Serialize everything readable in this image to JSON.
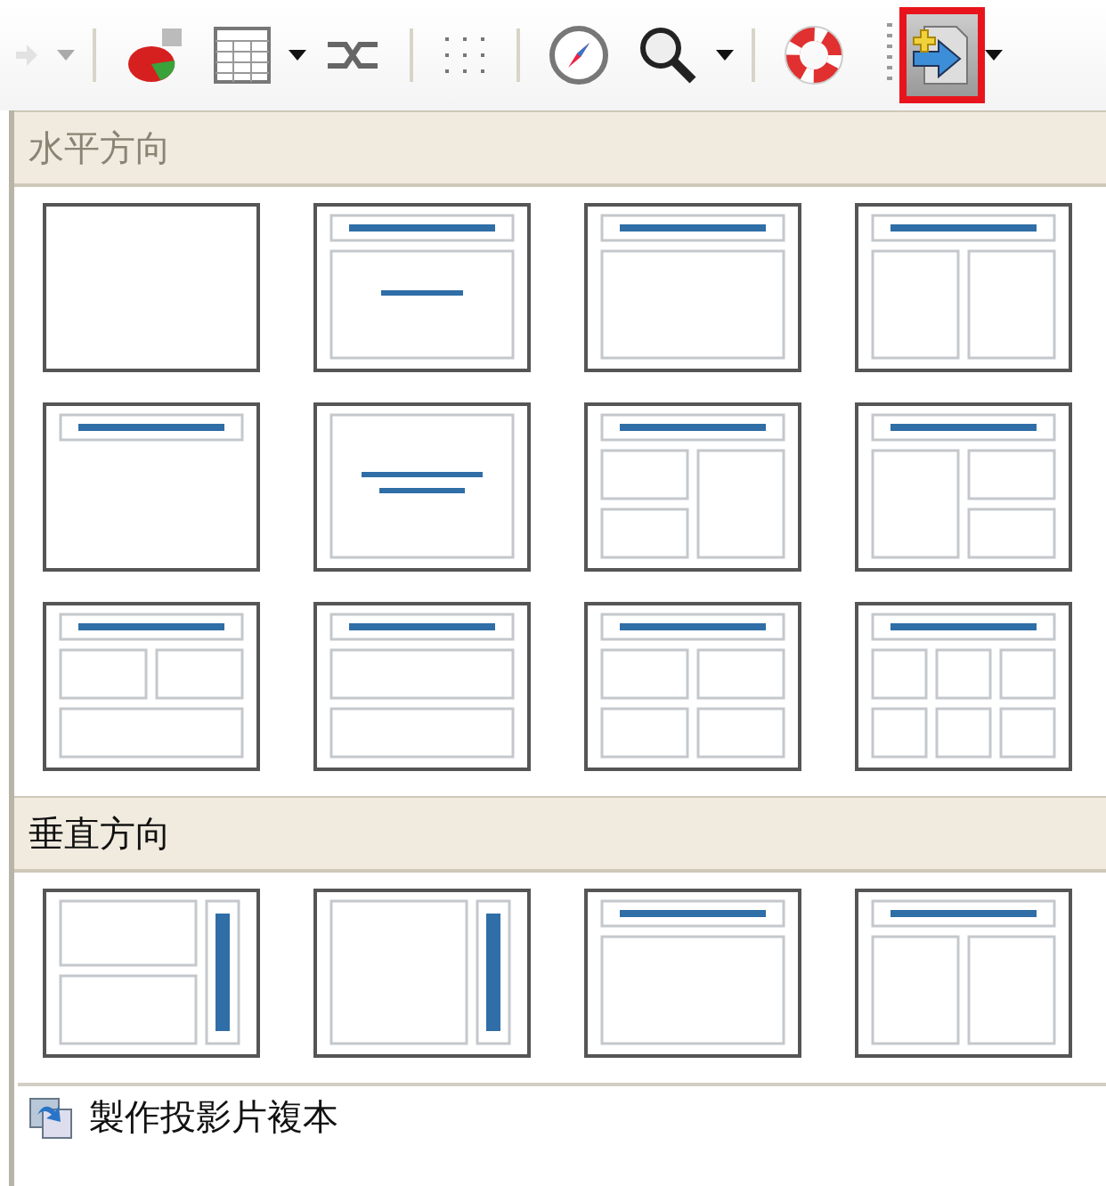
{
  "toolbar": [
    {
      "kind": "forward",
      "disabled": true,
      "dropdown": true,
      "selected": false
    },
    {
      "kind": "separator"
    },
    {
      "kind": "chart",
      "disabled": false,
      "dropdown": false,
      "selected": false
    },
    {
      "kind": "table",
      "disabled": false,
      "dropdown": true,
      "selected": false
    },
    {
      "kind": "link",
      "disabled": false,
      "dropdown": false,
      "selected": false
    },
    {
      "kind": "separator"
    },
    {
      "kind": "grid",
      "disabled": false,
      "dropdown": false,
      "selected": false
    },
    {
      "kind": "separator"
    },
    {
      "kind": "navigator",
      "disabled": false,
      "dropdown": false,
      "selected": false
    },
    {
      "kind": "zoom",
      "disabled": false,
      "dropdown": true,
      "selected": false
    },
    {
      "kind": "separator"
    },
    {
      "kind": "help",
      "disabled": false,
      "dropdown": false,
      "selected": false
    },
    {
      "kind": "grip"
    },
    {
      "kind": "slide-layout",
      "disabled": false,
      "dropdown": true,
      "selected": true
    }
  ],
  "sections": [
    {
      "title": "水平方向",
      "dimmed": true,
      "layouts": [
        {
          "kind": "blank"
        },
        {
          "kind": "title-subtitle"
        },
        {
          "kind": "title-content"
        },
        {
          "kind": "title-2content"
        },
        {
          "kind": "title-only"
        },
        {
          "kind": "centered-text"
        },
        {
          "kind": "title-2stacked-content"
        },
        {
          "kind": "title-content-2stacked"
        },
        {
          "kind": "title-2content-over-content"
        },
        {
          "kind": "title-content-over-content"
        },
        {
          "kind": "title-4content"
        },
        {
          "kind": "title-6content"
        }
      ]
    },
    {
      "title": "垂直方向",
      "dimmed": false,
      "layouts": [
        {
          "kind": "vertical-title-2stacked"
        },
        {
          "kind": "vertical-title-content"
        },
        {
          "kind": "title-content"
        },
        {
          "kind": "title-2content"
        }
      ]
    }
  ],
  "footer_item": {
    "label": "製作投影片複本"
  }
}
